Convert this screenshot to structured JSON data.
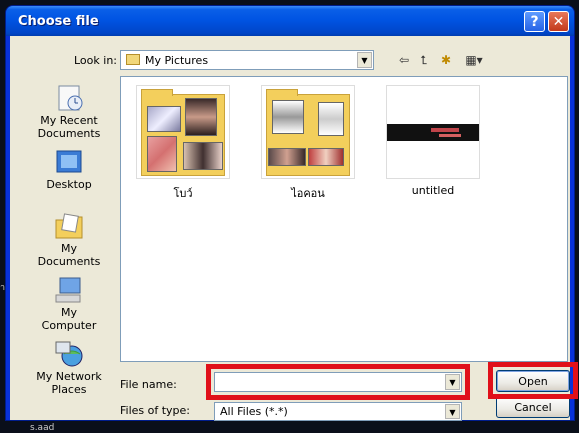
{
  "window": {
    "title": "Choose file",
    "help_glyph": "?",
    "close_glyph": "✕"
  },
  "lookin": {
    "label": "Look in:",
    "value": "My Pictures"
  },
  "toolbar": {
    "back_glyph": "⇦",
    "up_glyph": "⮤",
    "newfolder_glyph": "✱",
    "views_glyph": "▦▾"
  },
  "places": [
    {
      "label": "My Recent Documents",
      "icon": "recent-documents-icon"
    },
    {
      "label": "Desktop",
      "icon": "desktop-icon"
    },
    {
      "label": "My Documents",
      "icon": "my-documents-icon"
    },
    {
      "label": "My Computer",
      "icon": "my-computer-icon"
    },
    {
      "label": "My Network Places",
      "icon": "network-places-icon"
    }
  ],
  "files": [
    {
      "name": "โบว์",
      "kind": "folder"
    },
    {
      "name": "ไอคอน",
      "kind": "folder"
    },
    {
      "name": "untitled",
      "kind": "image"
    }
  ],
  "filename": {
    "label": "File name:",
    "value": ""
  },
  "filetype": {
    "label": "Files of type:",
    "value": "All Files (*.*)"
  },
  "buttons": {
    "open": "Open",
    "cancel": "Cancel"
  },
  "background": {
    "left_text": "าง",
    "bottom_text": "s.aad"
  },
  "colors": {
    "highlight": "#e0101a",
    "titlebar": "#0054e3"
  }
}
